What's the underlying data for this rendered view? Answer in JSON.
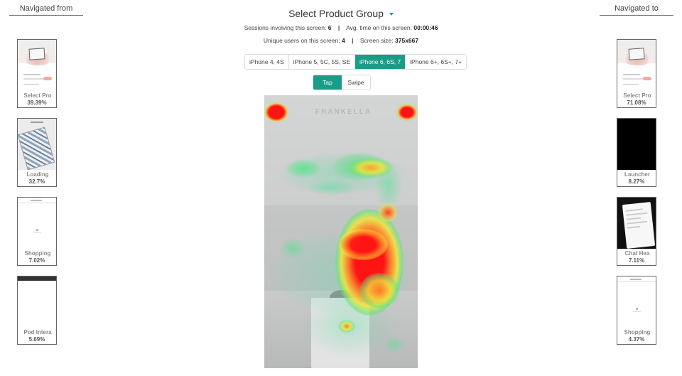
{
  "left_column": {
    "header": "Navigated from",
    "items": [
      {
        "name": "Select Pro",
        "percent": "39.39%"
      },
      {
        "name": "Loading",
        "percent": "32.7%"
      },
      {
        "name": "Shopping",
        "percent": "7.02%"
      },
      {
        "name": "Pod Intera",
        "percent": "5.69%"
      }
    ]
  },
  "right_column": {
    "header": "Navigated to",
    "items": [
      {
        "name": "Select Pro",
        "percent": "71.08%"
      },
      {
        "name": "Launcher",
        "percent": "8.27%"
      },
      {
        "name": "Chat Hea",
        "percent": "7.11%"
      },
      {
        "name": "Shopping",
        "percent": "4.37%"
      }
    ]
  },
  "screen": {
    "title": "Select Product Group",
    "sessions_label": "Sessions involving this screen:",
    "sessions_value": "6",
    "avg_time_label": "Avg. time on this screen:",
    "avg_time_value": "00:00:46",
    "unique_users_label": "Unique users on this screen:",
    "unique_users_value": "4",
    "screen_size_label": "Screen size:",
    "screen_size_value": "375x667",
    "separator": "|"
  },
  "device_tabs": [
    {
      "label": "iPhone 4, 4S",
      "active": false
    },
    {
      "label": "iPhone 5, 5C, 5S, SE",
      "active": false
    },
    {
      "label": "iPhone 6, 6S, 7",
      "active": true
    },
    {
      "label": "iPhone 6+, 6S+, 7+",
      "active": false
    }
  ],
  "mode_tabs": [
    {
      "label": "Tap",
      "active": true
    },
    {
      "label": "Swipe",
      "active": false
    }
  ],
  "heatmap": {
    "brand_text": "FRANKELLA"
  },
  "colors": {
    "accent": "#1a9d86",
    "heat_hot": "#ff1a1a",
    "heat_warm": "#f0e040",
    "heat_cool": "#40d890"
  }
}
